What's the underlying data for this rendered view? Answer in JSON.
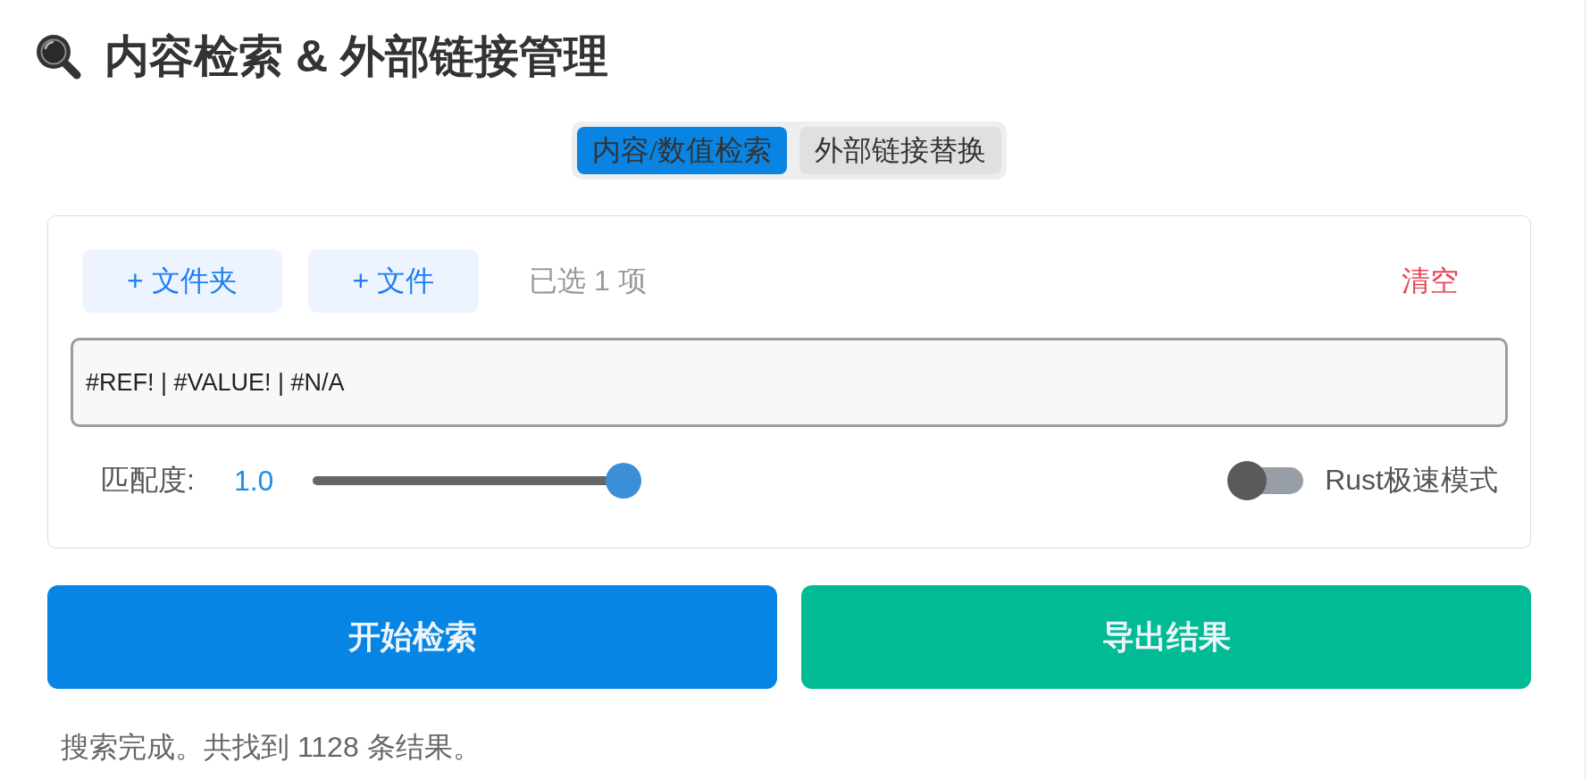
{
  "title": {
    "text": "内容检索 & 外部链接管理"
  },
  "tabs": [
    {
      "label": "内容/数值检索",
      "selected": true
    },
    {
      "label": "外部链接替换",
      "selected": false
    }
  ],
  "file_picker": {
    "add_folder": {
      "label": "+ 文件夹"
    },
    "add_file": {
      "label": "+ 文件"
    },
    "selection_count": "已选 1 项",
    "clear": {
      "label": "清空"
    }
  },
  "query": {
    "value": "#REF! | #VALUE! | #N/A"
  },
  "match": {
    "label": "匹配度:",
    "reading": "1.0",
    "level": 1.0
  },
  "rust_mode": {
    "label": "Rust极速模式",
    "on": false
  },
  "actions": [
    {
      "label": "开始检索",
      "kind": "search"
    },
    {
      "label": "导出结果",
      "kind": "export"
    }
  ],
  "status": {
    "text": "搜索完成。共找到 1128 条结果。"
  }
}
